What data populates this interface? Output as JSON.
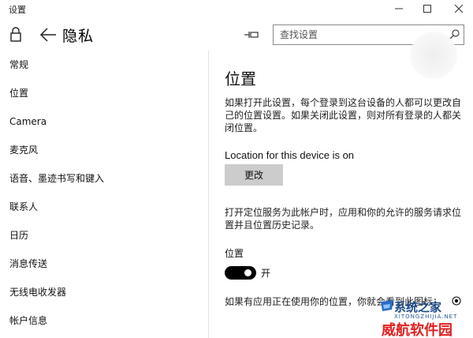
{
  "window": {
    "title": "设置",
    "minimize_icon": "minimize-icon",
    "maximize_icon": "maximize-icon",
    "close_icon": "close-icon"
  },
  "header": {
    "page_title": "隐私",
    "search_placeholder": "查找设置"
  },
  "sidebar": {
    "items": [
      {
        "label": "常规"
      },
      {
        "label": "位置"
      },
      {
        "label": "Camera"
      },
      {
        "label": "麦克风"
      },
      {
        "label": "语音、墨迹书写和键入"
      },
      {
        "label": "联系人"
      },
      {
        "label": "日历"
      },
      {
        "label": "消息传送"
      },
      {
        "label": "无线电收发器"
      },
      {
        "label": "帐户信息"
      }
    ]
  },
  "main": {
    "title": "位置",
    "description1": "如果打开此设置，每个登录到这台设备的人都可以更改自己的位置设置。如果关闭此设置，则对所有登录的人都关闭位置。",
    "device_status": "Location for this device is on",
    "change_button": "更改",
    "description2": "打开定位服务为此帐户时，应用和你的允许的服务请求位置并且位置历史记录。",
    "toggle_label": "位置",
    "toggle_state": "开",
    "footer_note": "如果有应用正在使用你的位置，你就会看到此图标：",
    "toggle_on": true
  },
  "watermark": {
    "line1": "系统之家",
    "sub": "XITONGZHIJIA.NET",
    "line2": "威航软件园"
  },
  "colors": {
    "toggle_on": "#000000",
    "button_bg": "#cccccc",
    "watermark_blue": "#1d4a86",
    "watermark_red": "#e22020"
  }
}
